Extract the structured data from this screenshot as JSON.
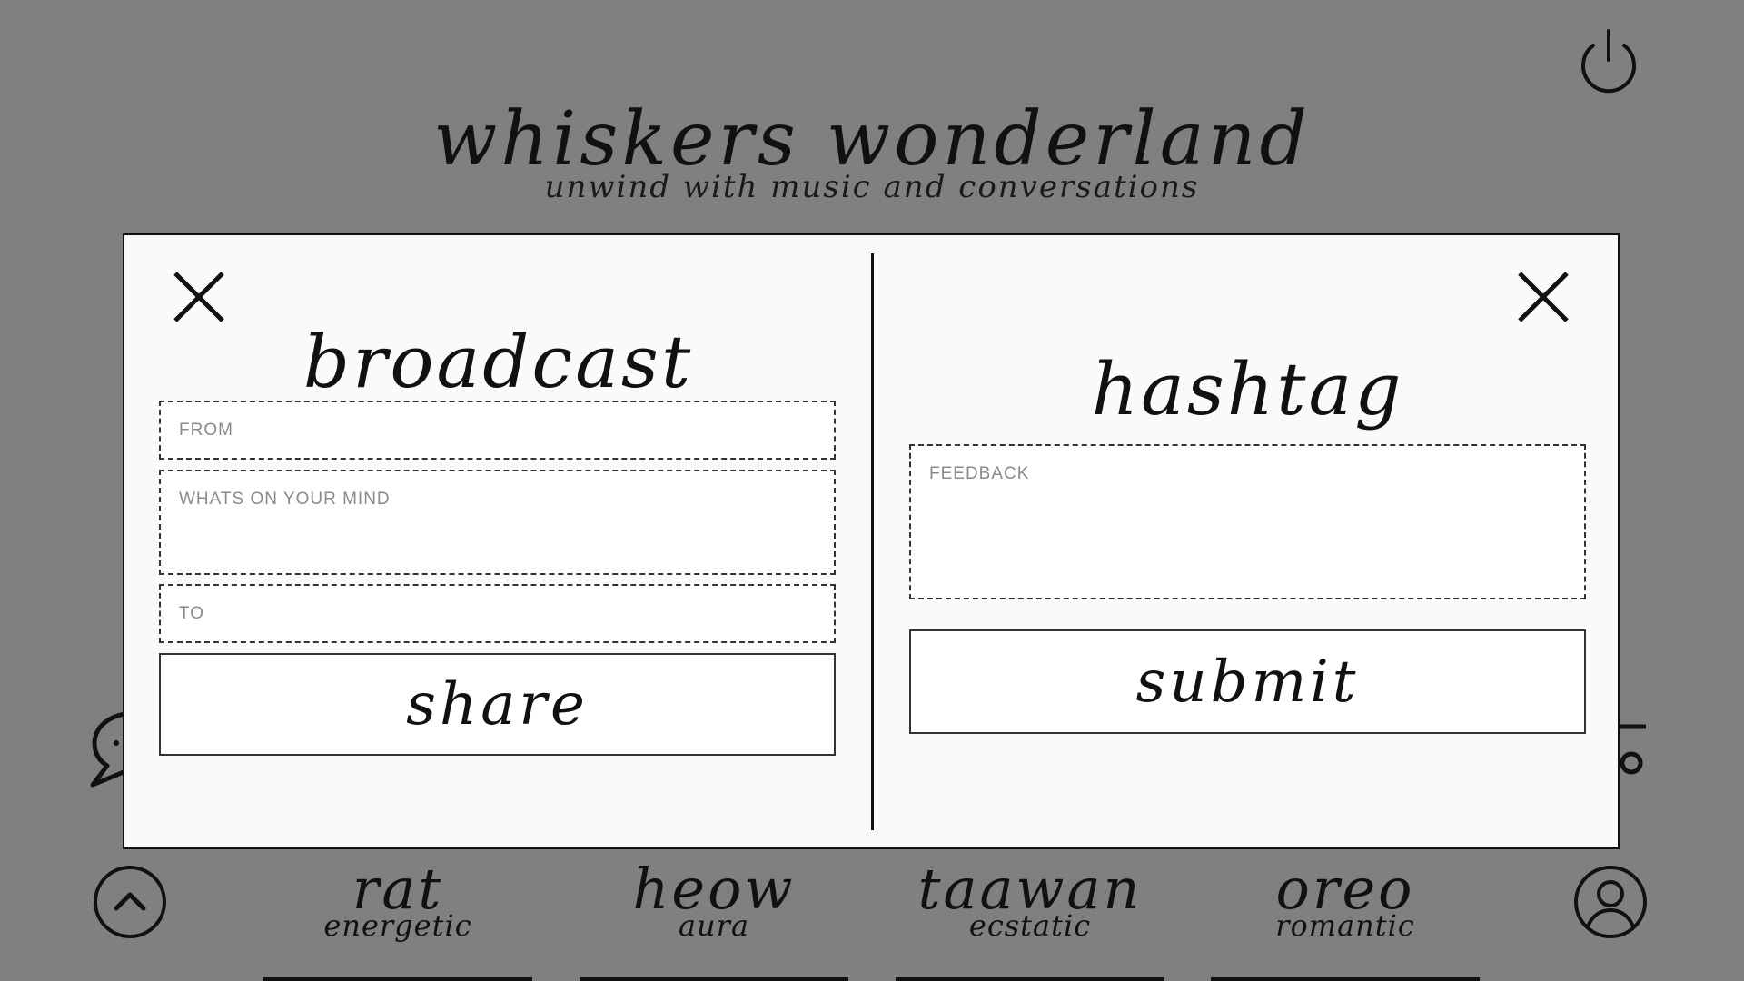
{
  "header": {
    "title": "whiskers wonderland",
    "subtitle": "unwind with music and conversations"
  },
  "top_bar": {
    "power_icon": "power-icon"
  },
  "broadcast": {
    "title": "broadcast",
    "close_icon": "close-icon",
    "from_placeholder": "FROM",
    "message_placeholder": "WHATS ON YOUR MIND",
    "to_placeholder": "TO",
    "share_label": "share"
  },
  "hashtag": {
    "title": "hashtag",
    "close_icon": "close-icon",
    "feedback_placeholder": "FEEDBACK",
    "submit_label": "submit"
  },
  "bottom_nav": {
    "up_icon": "chevron-up-icon",
    "profile_icon": "user-icon",
    "stations": [
      {
        "name": "rat",
        "mood": "energetic"
      },
      {
        "name": "heow",
        "mood": "aura"
      },
      {
        "name": "taawan",
        "mood": "ecstatic"
      },
      {
        "name": "oreo",
        "mood": "romantic"
      }
    ]
  },
  "colors": {
    "backdrop": "#808080",
    "modal": "#fafafa",
    "ink": "#111111",
    "placeholder": "#8a8a8a"
  }
}
